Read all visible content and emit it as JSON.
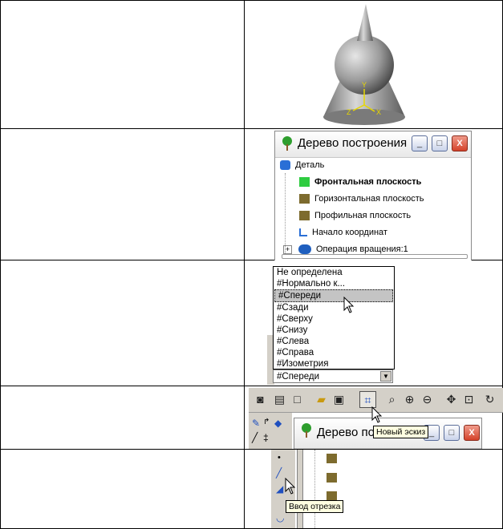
{
  "tree_window": {
    "title": "Дерево построения",
    "root": "Деталь",
    "items": [
      "Фронтальная плоскость",
      "Горизонтальная плоскость",
      "Профильная плоскость",
      "Начало координат",
      "Операция вращения:1"
    ],
    "minimize": "_",
    "maximize": "□",
    "close": "X"
  },
  "orientation_list": {
    "options": [
      "Не определена",
      "#Нормально к...",
      "#Спереди",
      "#Сзади",
      "#Сверху",
      "#Снизу",
      "#Слева",
      "#Справа",
      "#Изометрия"
    ],
    "selected_index": 2,
    "combo_value": "#Спереди"
  },
  "toolbar": {
    "tooltip": "Новый эскиз",
    "second_window_title": "Дерево пост"
  },
  "panel5": {
    "tooltip": "Ввод отрезка"
  },
  "axes": {
    "y": "Y",
    "x": "X",
    "z": "Z"
  },
  "colors": {
    "plane_front": "#2ecc40",
    "plane_other": "#7d6b2e",
    "selection": "#c4c4c4",
    "tooltip_bg": "#ffffe1"
  }
}
